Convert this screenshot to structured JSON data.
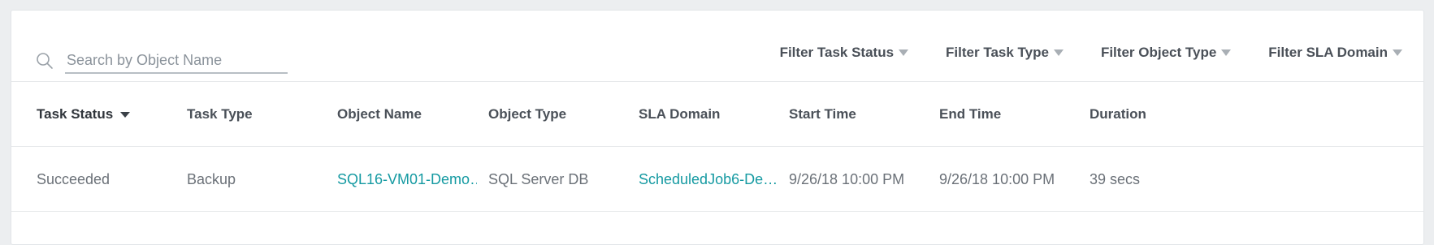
{
  "search": {
    "placeholder": "Search by Object Name",
    "value": ""
  },
  "filters": [
    {
      "label": "Filter Task Status"
    },
    {
      "label": "Filter Task Type"
    },
    {
      "label": "Filter Object Type"
    },
    {
      "label": "Filter SLA Domain"
    }
  ],
  "table": {
    "columns": [
      "Task Status",
      "Task Type",
      "Object Name",
      "Object Type",
      "SLA Domain",
      "Start Time",
      "End Time",
      "Duration"
    ],
    "sorted_column": "Task Status",
    "rows": [
      {
        "task_status": "Succeeded",
        "task_type": "Backup",
        "object_name": "SQL16-VM01-Demo…",
        "object_type": "SQL Server DB",
        "sla_domain": "ScheduledJob6-De…",
        "start_time": "9/26/18 10:00 PM",
        "end_time": "9/26/18 10:00 PM",
        "duration": "39 secs"
      }
    ]
  },
  "colors": {
    "link": "#159aa2",
    "text": "#6b7178",
    "header": "#4a5058"
  },
  "icons": {
    "search": "search-icon",
    "filter_caret": "caret-down-icon",
    "sort": "sort-desc-icon"
  }
}
